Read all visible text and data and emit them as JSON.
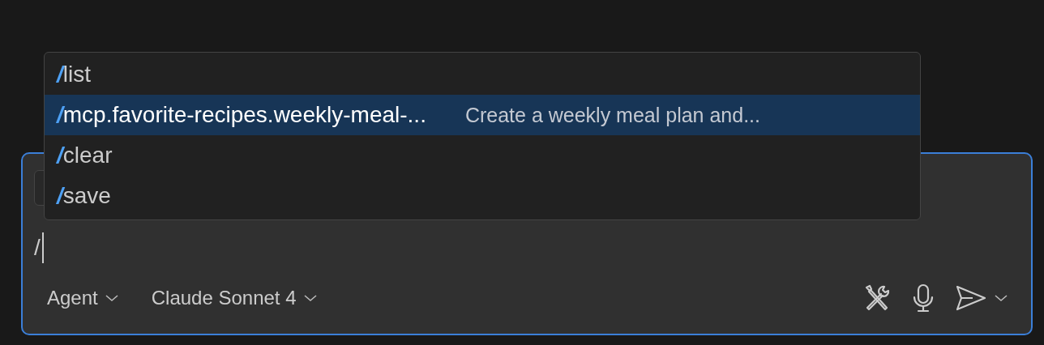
{
  "suggestions": [
    {
      "prefix": "/",
      "command": "list",
      "selected": false
    },
    {
      "prefix": "/",
      "command": "mcp.favorite-recipes.weekly-meal-...",
      "description": "Create a weekly meal plan and...",
      "selected": true
    },
    {
      "prefix": "/",
      "command": "clear",
      "selected": false
    },
    {
      "prefix": "/",
      "command": "save",
      "selected": false
    }
  ],
  "input": {
    "value": "/"
  },
  "mode_picker": {
    "label": "Agent"
  },
  "model_picker": {
    "label": "Claude Sonnet 4"
  }
}
